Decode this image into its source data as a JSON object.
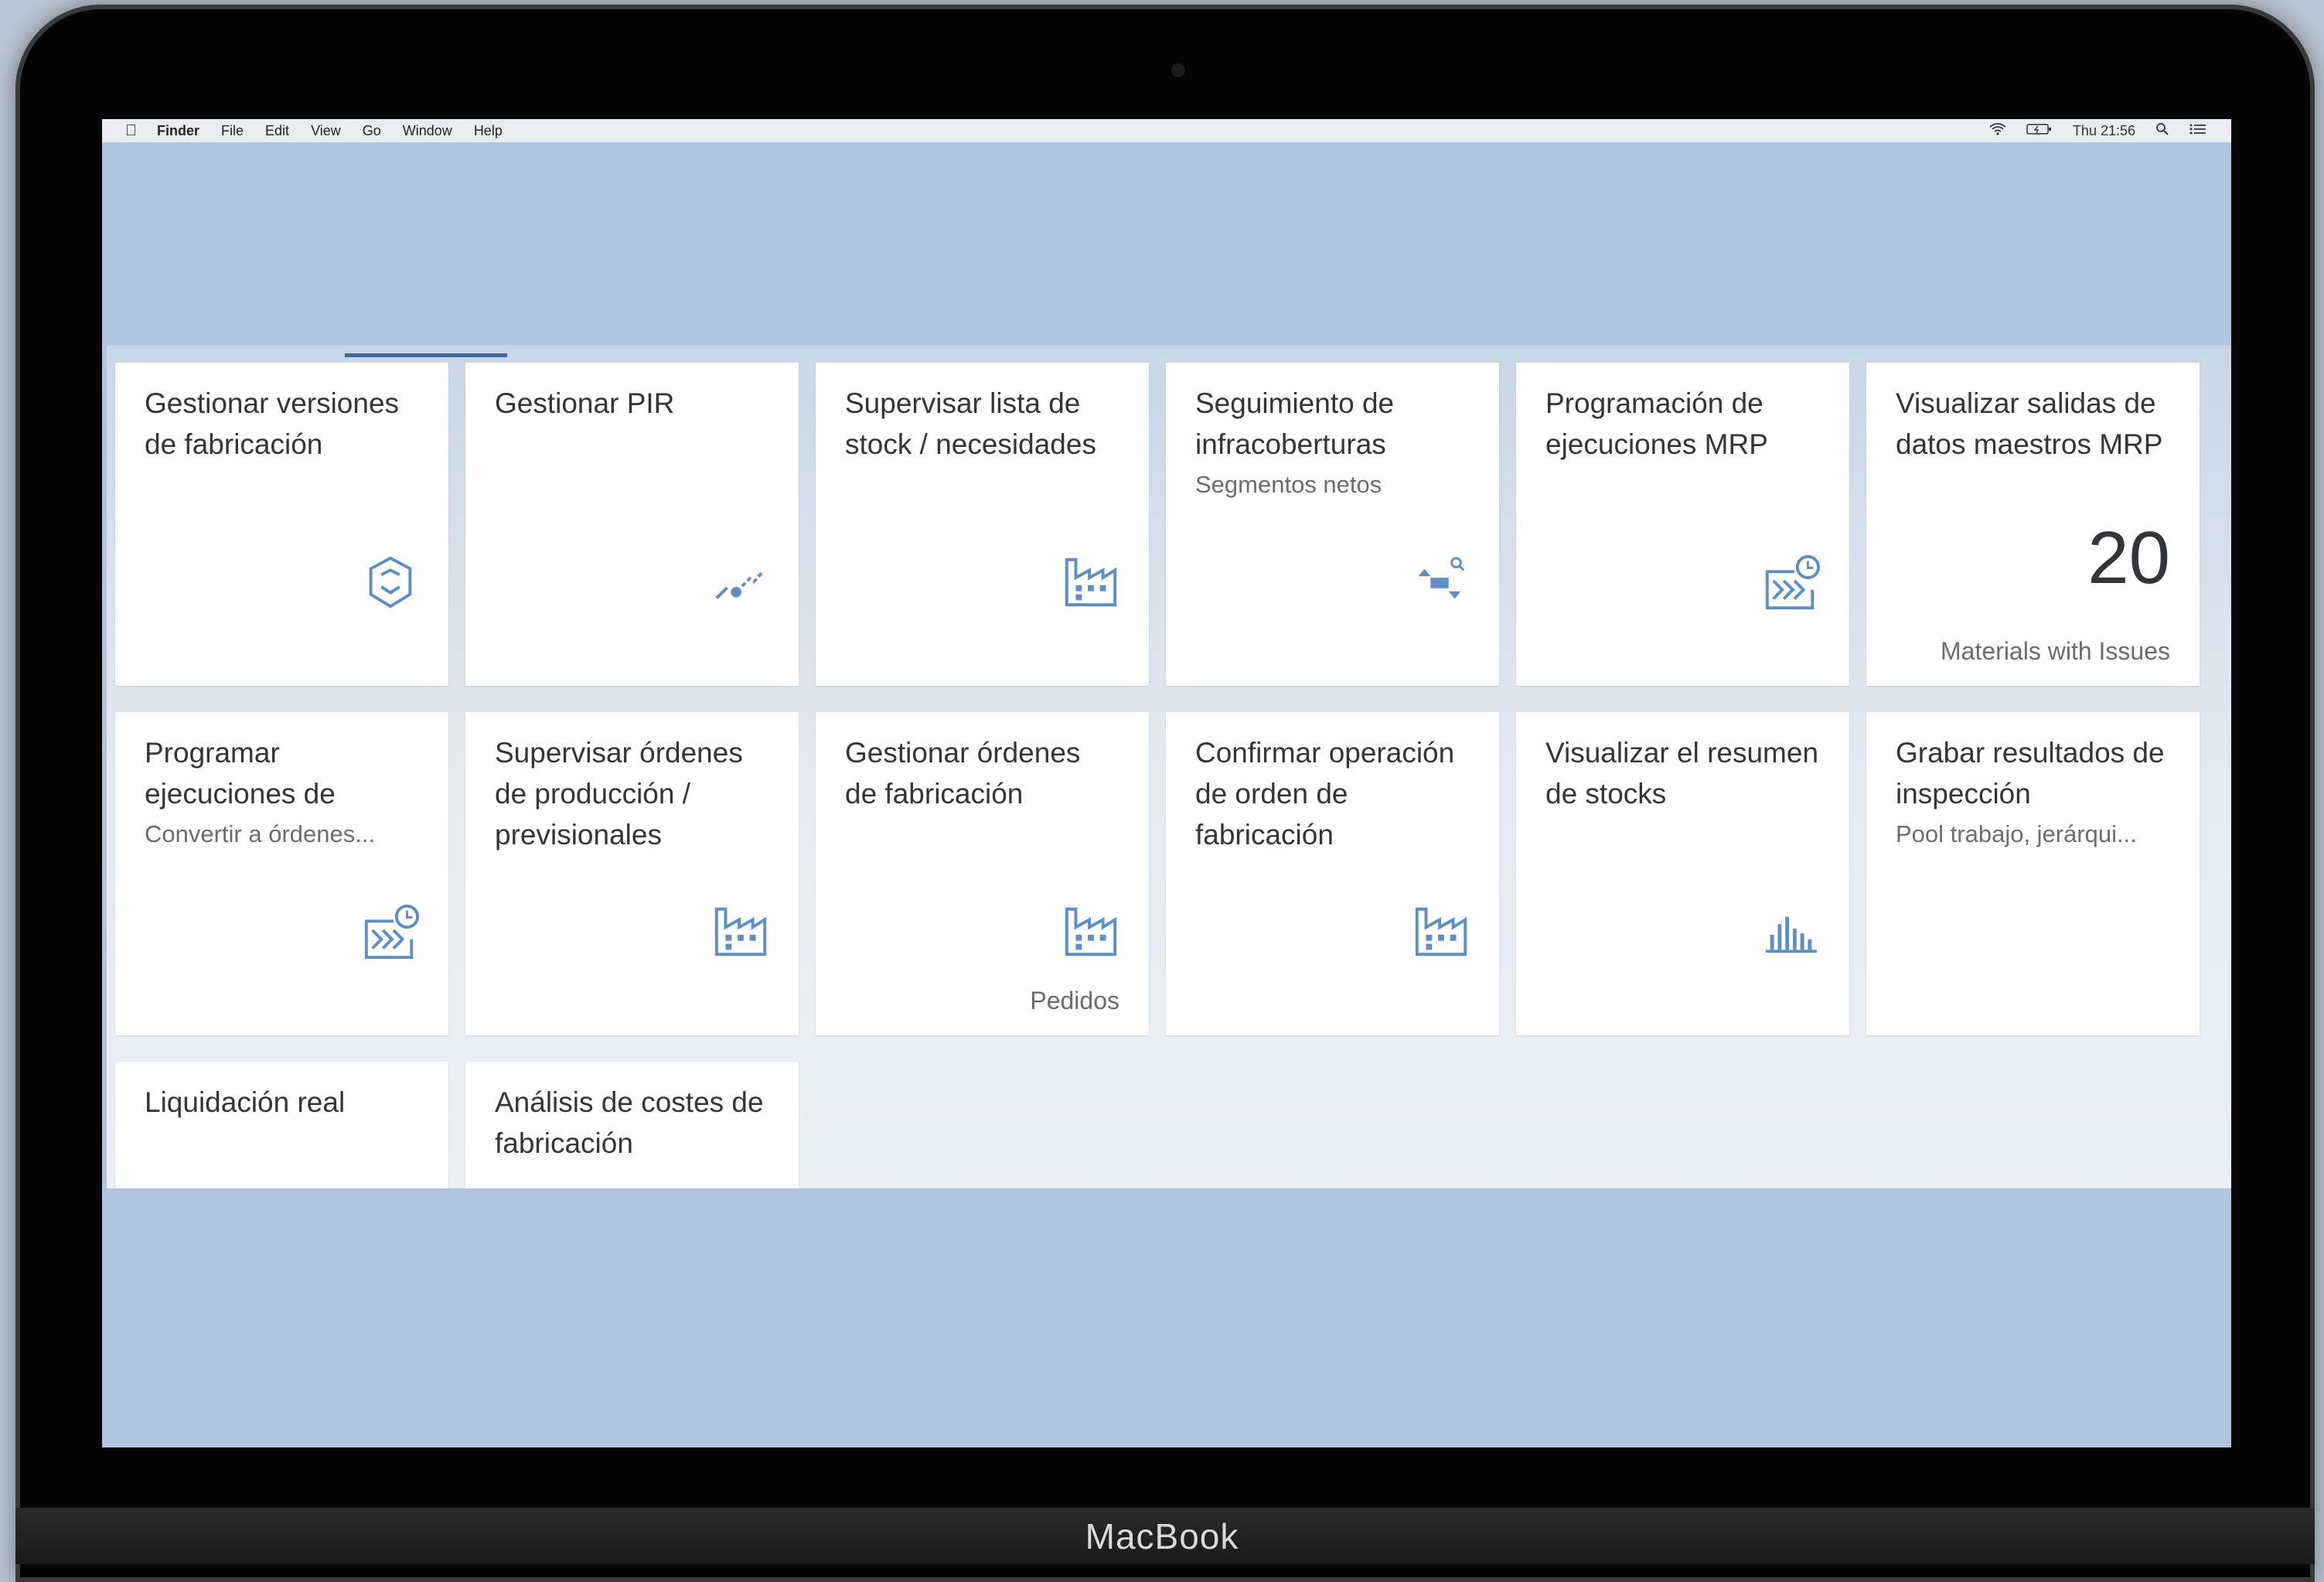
{
  "menubar": {
    "apple": "",
    "items": [
      "Finder",
      "File",
      "Edit",
      "View",
      "Go",
      "Window",
      "Help"
    ],
    "clock": "Thu 21:56"
  },
  "device_label": "MacBook",
  "tiles": [
    {
      "title": "Gestionar versiones de fabricación",
      "icon": "cube-icon"
    },
    {
      "title": "Gestionar PIR",
      "icon": "trend-icon"
    },
    {
      "title": "Supervisar lista de stock / necesidades",
      "icon": "factory-icon"
    },
    {
      "title": "Seguimiento de infracoberturas",
      "subtitle": "Segmentos netos",
      "icon": "shortage-icon"
    },
    {
      "title": "Programación de ejecuciones MRP",
      "icon": "schedule-icon"
    },
    {
      "title": "Visualizar salidas de datos maestros MRP",
      "number": "20",
      "footer": "Materials with Issues"
    },
    {
      "title": "Programar ejecuciones de",
      "subtitle": "Convertir a órdenes...",
      "icon": "schedule-icon"
    },
    {
      "title": "Supervisar órdenes de producción / previsionales",
      "icon": "factory-icon"
    },
    {
      "title": "Gestionar órdenes de fabricación",
      "icon": "factory-icon",
      "footer": "Pedidos"
    },
    {
      "title": "Confirmar operación de orden de fabricación",
      "icon": "factory-icon"
    },
    {
      "title": "Visualizar el resumen de stocks",
      "icon": "bar-chart-icon"
    },
    {
      "title": "Grabar resultados de inspección",
      "subtitle": "Pool trabajo, jerárqui..."
    },
    {
      "title": "Liquidación real"
    },
    {
      "title": "Análisis de costes de fabricación"
    }
  ]
}
